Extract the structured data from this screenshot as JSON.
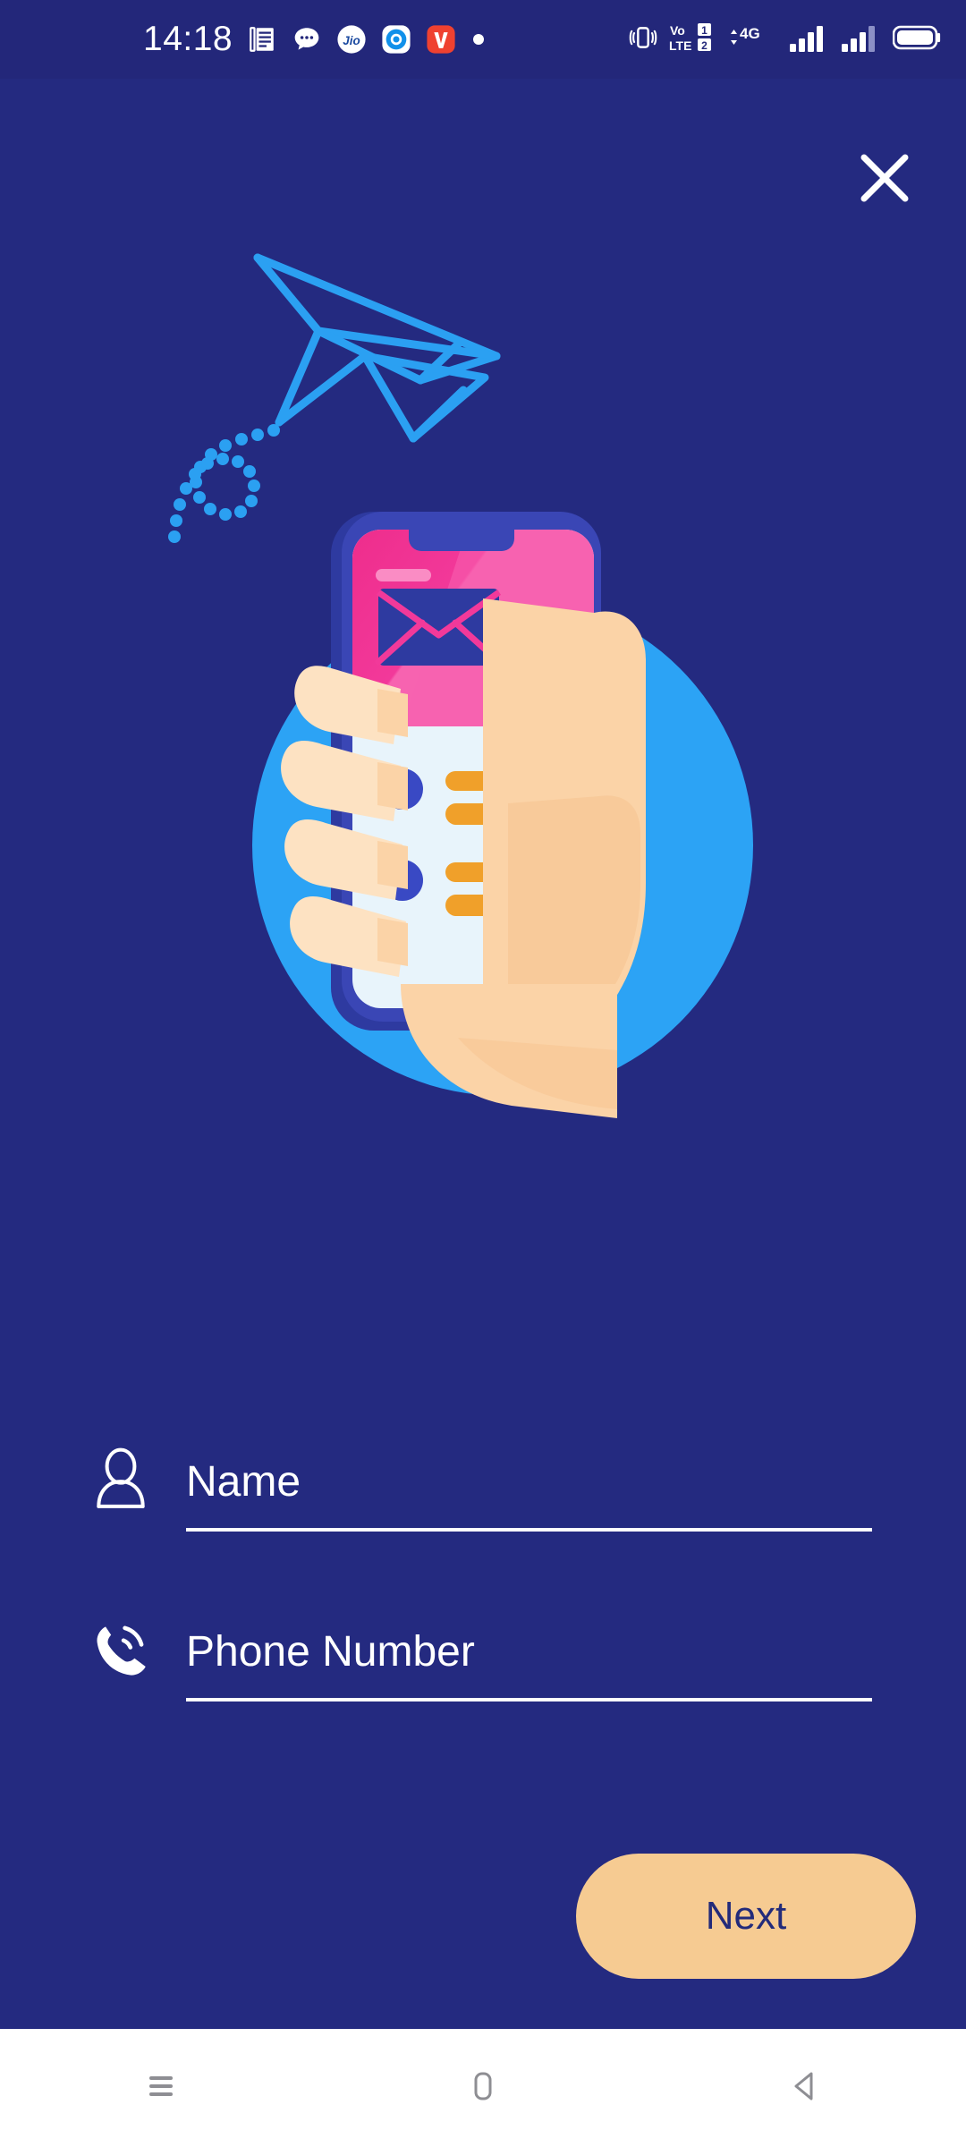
{
  "theme": {
    "background": "#242A80",
    "status_bar_bg": "#23277A",
    "accent_button": "#F6CB92",
    "button_text": "#232B7A",
    "field_text": "#FFFFFF",
    "plane_blue": "#2BA0F2",
    "circle_blue": "#2CA3F5",
    "phone_frame": "#3A46B5",
    "phone_pink": "#EE2D8C",
    "phone_pink_light": "#F763B0",
    "phone_screen": "#E8F4FB",
    "list_orange": "#F0A02A",
    "list_dot": "#3949C4",
    "skin": "#FBD3A7",
    "skin_light": "#FDE2C2",
    "nav_bar_bg": "#FFFFFF",
    "nav_icon": "#8E8E93"
  },
  "status_bar": {
    "time": "14:18",
    "notification_icons": [
      "news-document-icon",
      "chat-bubble-icon",
      "jio-app-icon",
      "ring-app-icon",
      "v-app-icon",
      "dot-icon"
    ],
    "right_icons": [
      "vibrate-icon",
      "volte-dual-sim-icon",
      "4g-data-icon",
      "signal-sim1-icon",
      "signal-sim2-icon",
      "battery-icon"
    ],
    "volte_label": "VoLTE",
    "sim1_label": "1",
    "sim2_label": "2",
    "network_label": "4G"
  },
  "header": {
    "close_label": "close-button"
  },
  "illustration": {
    "name": "hand-holding-phone-with-paper-plane",
    "paper_plane": "paper-plane-icon",
    "envelope": "envelope-icon",
    "list_rows": 4
  },
  "form": {
    "fields": [
      {
        "id": "name",
        "icon": "person-icon",
        "placeholder": "Name",
        "value": ""
      },
      {
        "id": "phone",
        "icon": "phone-ringing-icon",
        "placeholder": "Phone Number",
        "value": ""
      }
    ]
  },
  "actions": {
    "next_label": "Next"
  },
  "nav_bar": {
    "items": [
      {
        "id": "recents",
        "icon": "hamburger-menu-icon"
      },
      {
        "id": "home",
        "icon": "home-square-icon"
      },
      {
        "id": "back",
        "icon": "back-triangle-icon"
      }
    ]
  }
}
